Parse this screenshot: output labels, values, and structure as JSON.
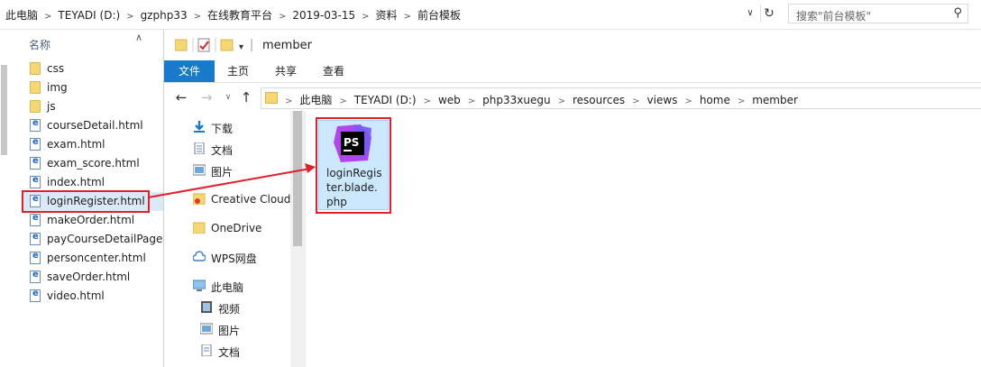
{
  "topbar": {
    "breadcrumbs": [
      "此电脑",
      "TEYADI (D:)",
      "gzphp33",
      "在线教育平台",
      "2019-03-15",
      "资料",
      "前台模板"
    ],
    "search_placeholder": "搜索\"前台模板\""
  },
  "left_pane": {
    "column_header": "名称",
    "items": [
      {
        "type": "folder",
        "name": "css"
      },
      {
        "type": "folder",
        "name": "img"
      },
      {
        "type": "folder",
        "name": "js"
      },
      {
        "type": "html",
        "name": "courseDetail.html"
      },
      {
        "type": "html",
        "name": "exam.html"
      },
      {
        "type": "html",
        "name": "exam_score.html"
      },
      {
        "type": "html",
        "name": "index.html"
      },
      {
        "type": "html",
        "name": "loginRegister.html",
        "selected": true
      },
      {
        "type": "html",
        "name": "makeOrder.html"
      },
      {
        "type": "html",
        "name": "payCourseDetailPage.h"
      },
      {
        "type": "html",
        "name": "personcenter.html"
      },
      {
        "type": "html",
        "name": "saveOrder.html"
      },
      {
        "type": "html",
        "name": "video.html"
      }
    ]
  },
  "window": {
    "title": "member",
    "tabs": {
      "file": "文件",
      "home": "主页",
      "share": "共享",
      "view": "查看"
    },
    "address": [
      "此电脑",
      "TEYADI (D:)",
      "web",
      "php33xuegu",
      "resources",
      "views",
      "home",
      "member"
    ],
    "nav_items": [
      {
        "label": "下载",
        "icon": "download-icon",
        "pinned": true
      },
      {
        "label": "文档",
        "icon": "document-icon",
        "pinned": true
      },
      {
        "label": "图片",
        "icon": "picture-icon",
        "pinned": true
      },
      {
        "label": "Creative Cloud F",
        "icon": "creative-cloud-icon",
        "pinned": false
      },
      {
        "label": "OneDrive",
        "icon": "folder-icon",
        "pinned": false
      },
      {
        "label": "WPS网盘",
        "icon": "cloud-icon",
        "pinned": false
      },
      {
        "label": "此电脑",
        "icon": "computer-icon",
        "pinned": false
      },
      {
        "label": "视频",
        "icon": "video-icon",
        "pinned": false
      },
      {
        "label": "图片",
        "icon": "picture-icon",
        "pinned": false
      },
      {
        "label": "文档",
        "icon": "document-icon",
        "pinned": false
      }
    ],
    "file": {
      "name": "loginRegister.blade.php",
      "icon_text": "PS"
    }
  },
  "colors": {
    "accent": "#1979ca",
    "highlight": "#e0202a",
    "selection": "#cce8ff"
  }
}
